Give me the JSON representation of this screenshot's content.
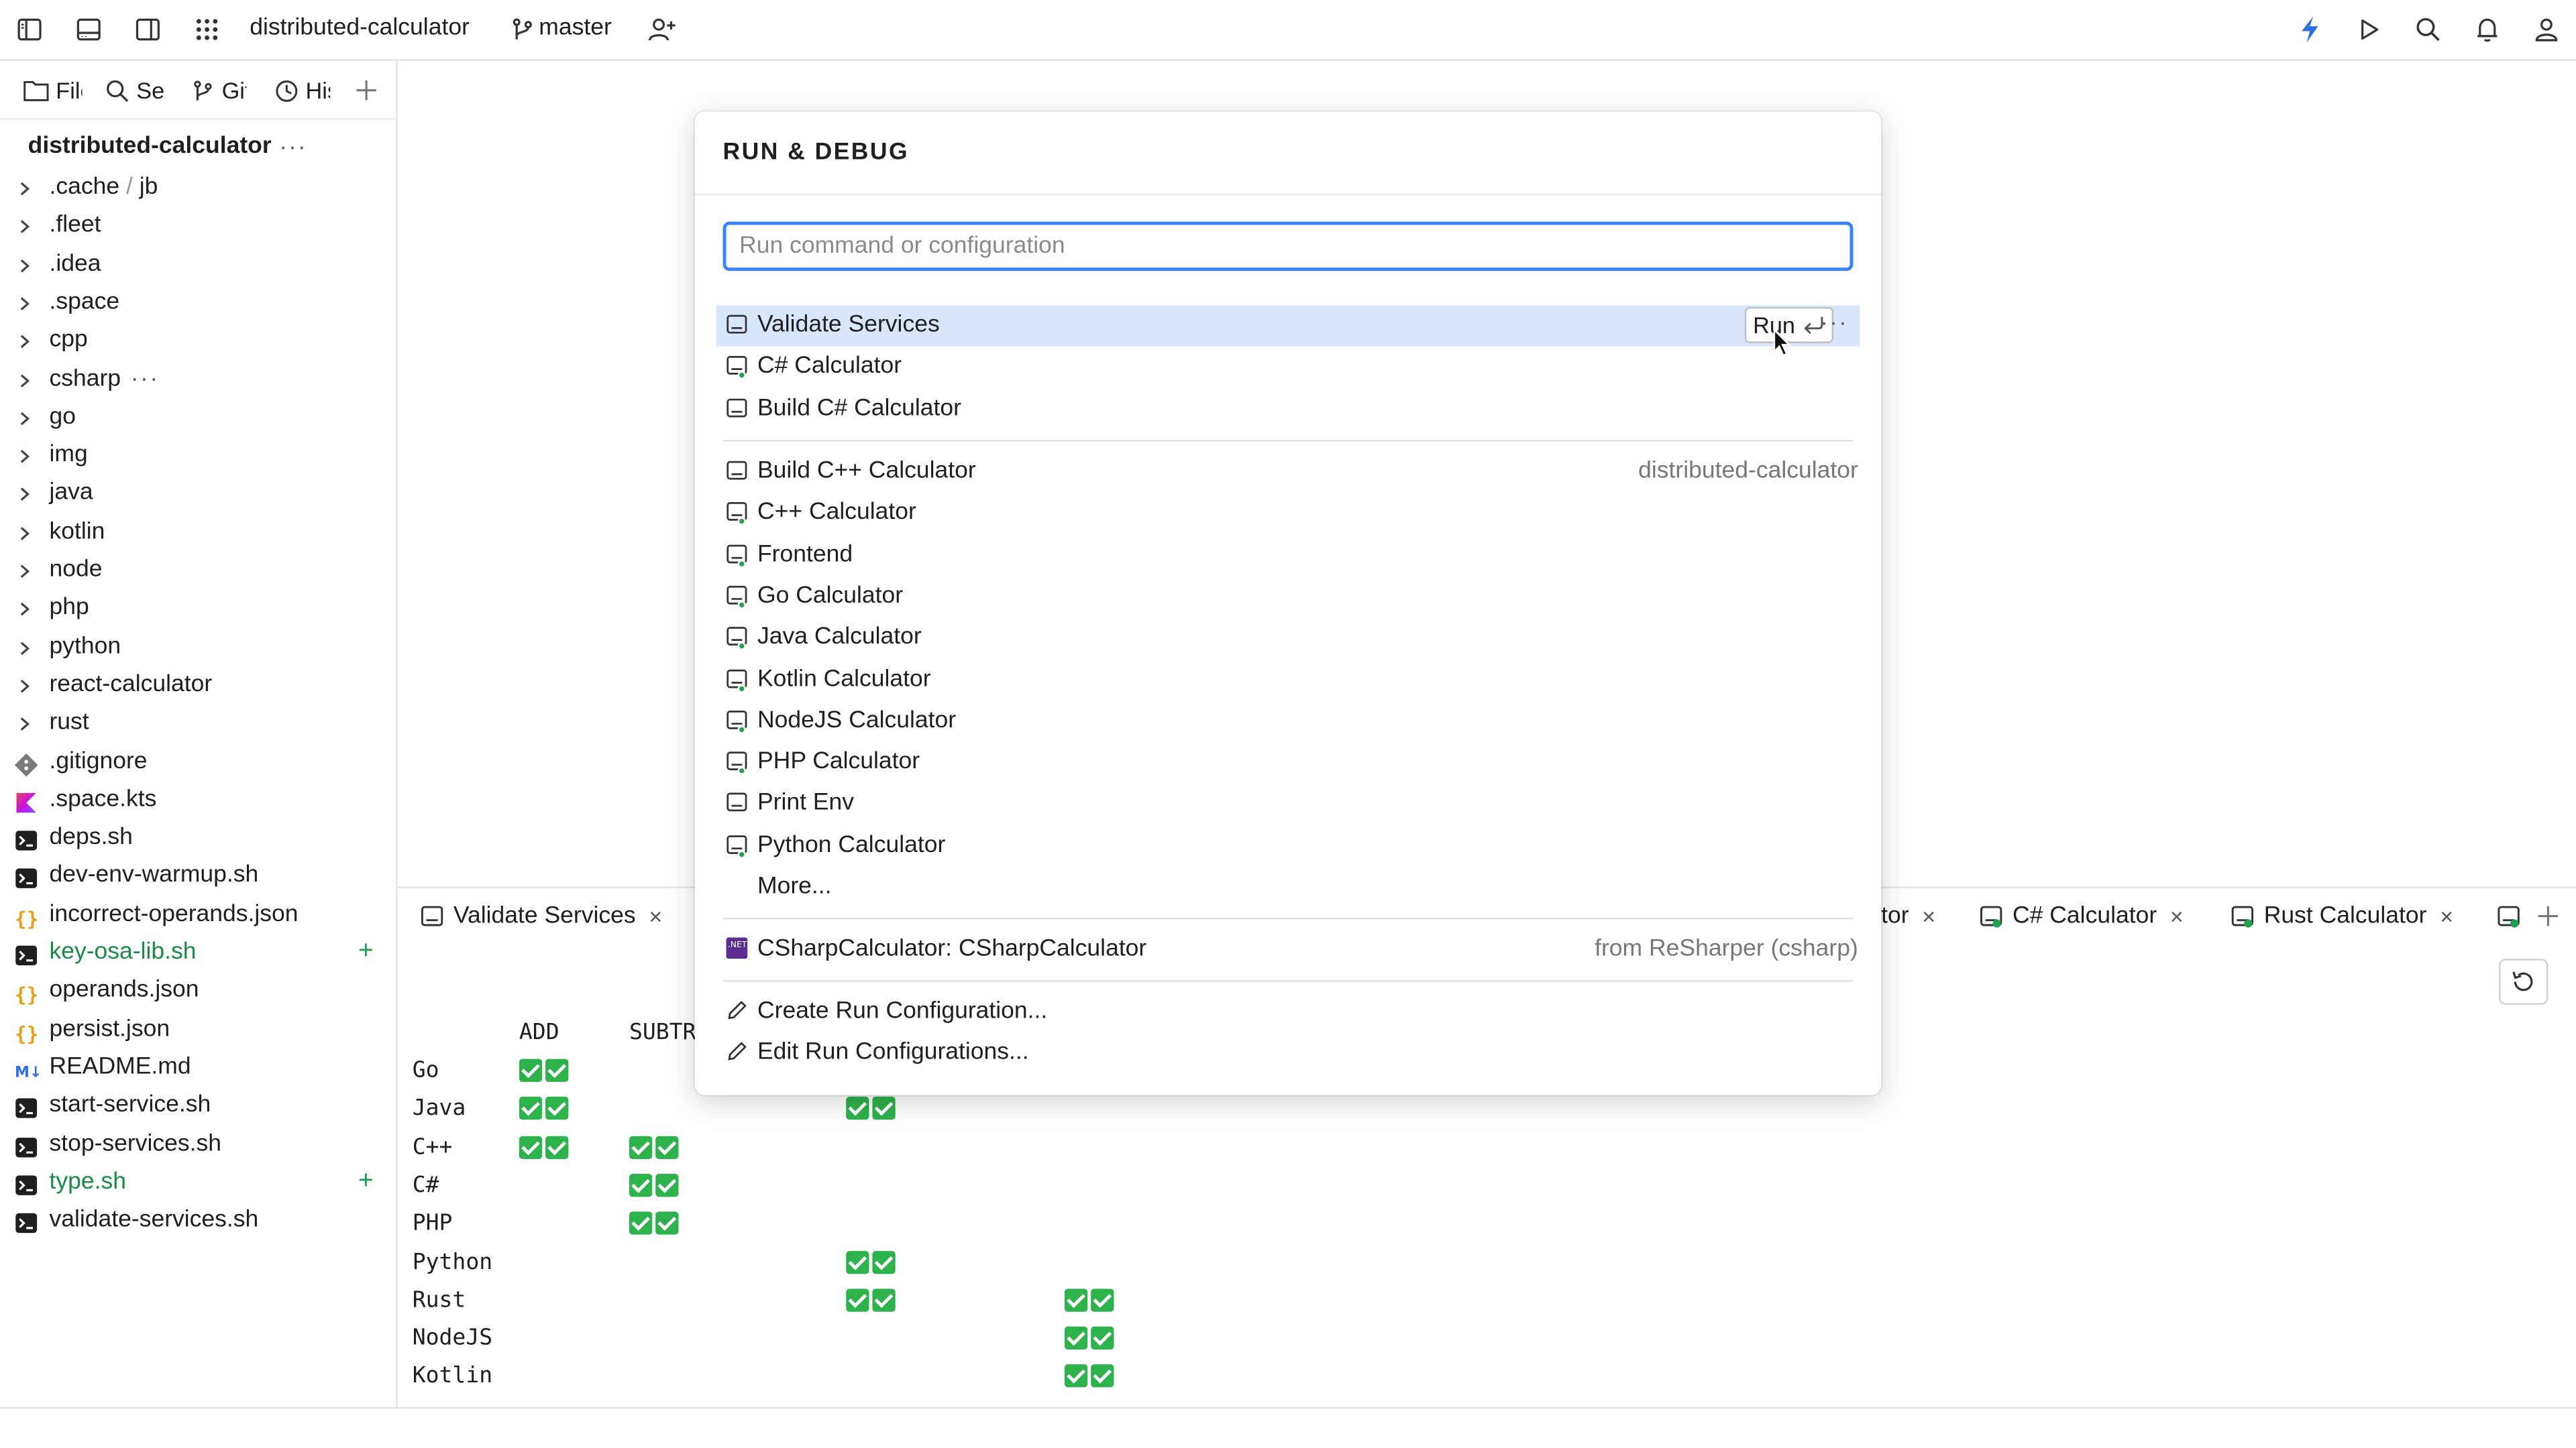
{
  "topbar": {
    "project": "distributed-calculator",
    "branch": "master",
    "icons": [
      "sidebar-left-icon",
      "panel-bottom-icon",
      "sidebar-right-icon",
      "apps-grid-icon",
      "git-branch-icon",
      "add-user-icon",
      "lightning-icon",
      "run-icon",
      "search-icon",
      "bell-icon",
      "user-icon"
    ]
  },
  "left_tabs": [
    {
      "label": "Files"
    },
    {
      "label": "Search"
    },
    {
      "label": "Git"
    },
    {
      "label": "History"
    }
  ],
  "project_tree": {
    "title": "distributed-calculator",
    "folders": [
      ".cache",
      ".fleet",
      ".idea",
      ".space",
      "cpp",
      "csharp",
      "go",
      "img",
      "java",
      "kotlin",
      "node",
      "php",
      "python",
      "react-calculator",
      "rust"
    ],
    "cache_sub": "jb",
    "files": [
      {
        "name": ".gitignore",
        "icon": "git-file-icon"
      },
      {
        "name": ".space.kts",
        "icon": "kotlin-file-icon"
      },
      {
        "name": "deps.sh",
        "icon": "shell-file-icon"
      },
      {
        "name": "dev-env-warmup.sh",
        "icon": "shell-file-icon"
      },
      {
        "name": "incorrect-operands.json",
        "icon": "json-file-icon"
      },
      {
        "name": "key-osa-lib.sh",
        "icon": "shell-file-icon",
        "status": "added"
      },
      {
        "name": "operands.json",
        "icon": "json-file-icon"
      },
      {
        "name": "persist.json",
        "icon": "json-file-icon"
      },
      {
        "name": "README.md",
        "icon": "markdown-file-icon"
      },
      {
        "name": "start-service.sh",
        "icon": "shell-file-icon"
      },
      {
        "name": "stop-services.sh",
        "icon": "shell-file-icon"
      },
      {
        "name": "type.sh",
        "icon": "shell-file-icon",
        "status": "added"
      },
      {
        "name": "validate-services.sh",
        "icon": "shell-file-icon"
      }
    ],
    "added_mark": "+",
    "md_badge": "M↓"
  },
  "popup": {
    "title": "RUN & DEBUG",
    "search_placeholder": "Run command or configuration",
    "run_label": "Run",
    "group1": [
      {
        "label": "Validate Services",
        "selected": true,
        "dot": false
      },
      {
        "label": "C# Calculator",
        "dot": true
      },
      {
        "label": "Build C# Calculator",
        "dot": false
      }
    ],
    "group2_hint": "distributed-calculator",
    "group2": [
      {
        "label": "Build C++ Calculator",
        "dot": false
      },
      {
        "label": "C++ Calculator",
        "dot": true
      },
      {
        "label": "Frontend",
        "dot": true
      },
      {
        "label": "Go Calculator",
        "dot": true
      },
      {
        "label": "Java Calculator",
        "dot": true
      },
      {
        "label": "Kotlin Calculator",
        "dot": true
      },
      {
        "label": "NodeJS Calculator",
        "dot": true
      },
      {
        "label": "PHP Calculator",
        "dot": true
      },
      {
        "label": "Print Env",
        "dot": false
      },
      {
        "label": "Python Calculator",
        "dot": true
      },
      {
        "label": "More...",
        "icon": false
      }
    ],
    "resharper": {
      "label": "CSharpCalculator: CSharpCalculator",
      "hint": "from ReSharper (csharp)",
      "badge": ".NET"
    },
    "actions": [
      "Create Run Configuration...",
      "Edit Run Configurations..."
    ]
  },
  "bottom": {
    "tabs": [
      {
        "label": "Validate Services"
      },
      {
        "label": "tor"
      },
      {
        "label": "C# Calculator"
      },
      {
        "label": "Rust Calculator"
      }
    ],
    "close": "×",
    "table": {
      "headers": [
        "ADD",
        "SUBTR"
      ],
      "rows": [
        {
          "name": "Go",
          "marks": [
            0
          ]
        },
        {
          "name": "Java",
          "marks": [
            0,
            2
          ]
        },
        {
          "name": "C++",
          "marks": [
            0,
            1
          ]
        },
        {
          "name": "C#",
          "marks": [
            1
          ]
        },
        {
          "name": "PHP",
          "marks": [
            1
          ]
        },
        {
          "name": "Python",
          "marks": [
            2
          ]
        },
        {
          "name": "Rust",
          "marks": [
            2,
            3
          ]
        },
        {
          "name": "NodeJS",
          "marks": [
            3
          ]
        },
        {
          "name": "Kotlin",
          "marks": [
            3
          ]
        }
      ]
    }
  },
  "colors": {
    "accent": "#3b82f6",
    "selected_row": "#d8e6fb",
    "added": "#1a8a46",
    "check": "#2eb24b"
  }
}
